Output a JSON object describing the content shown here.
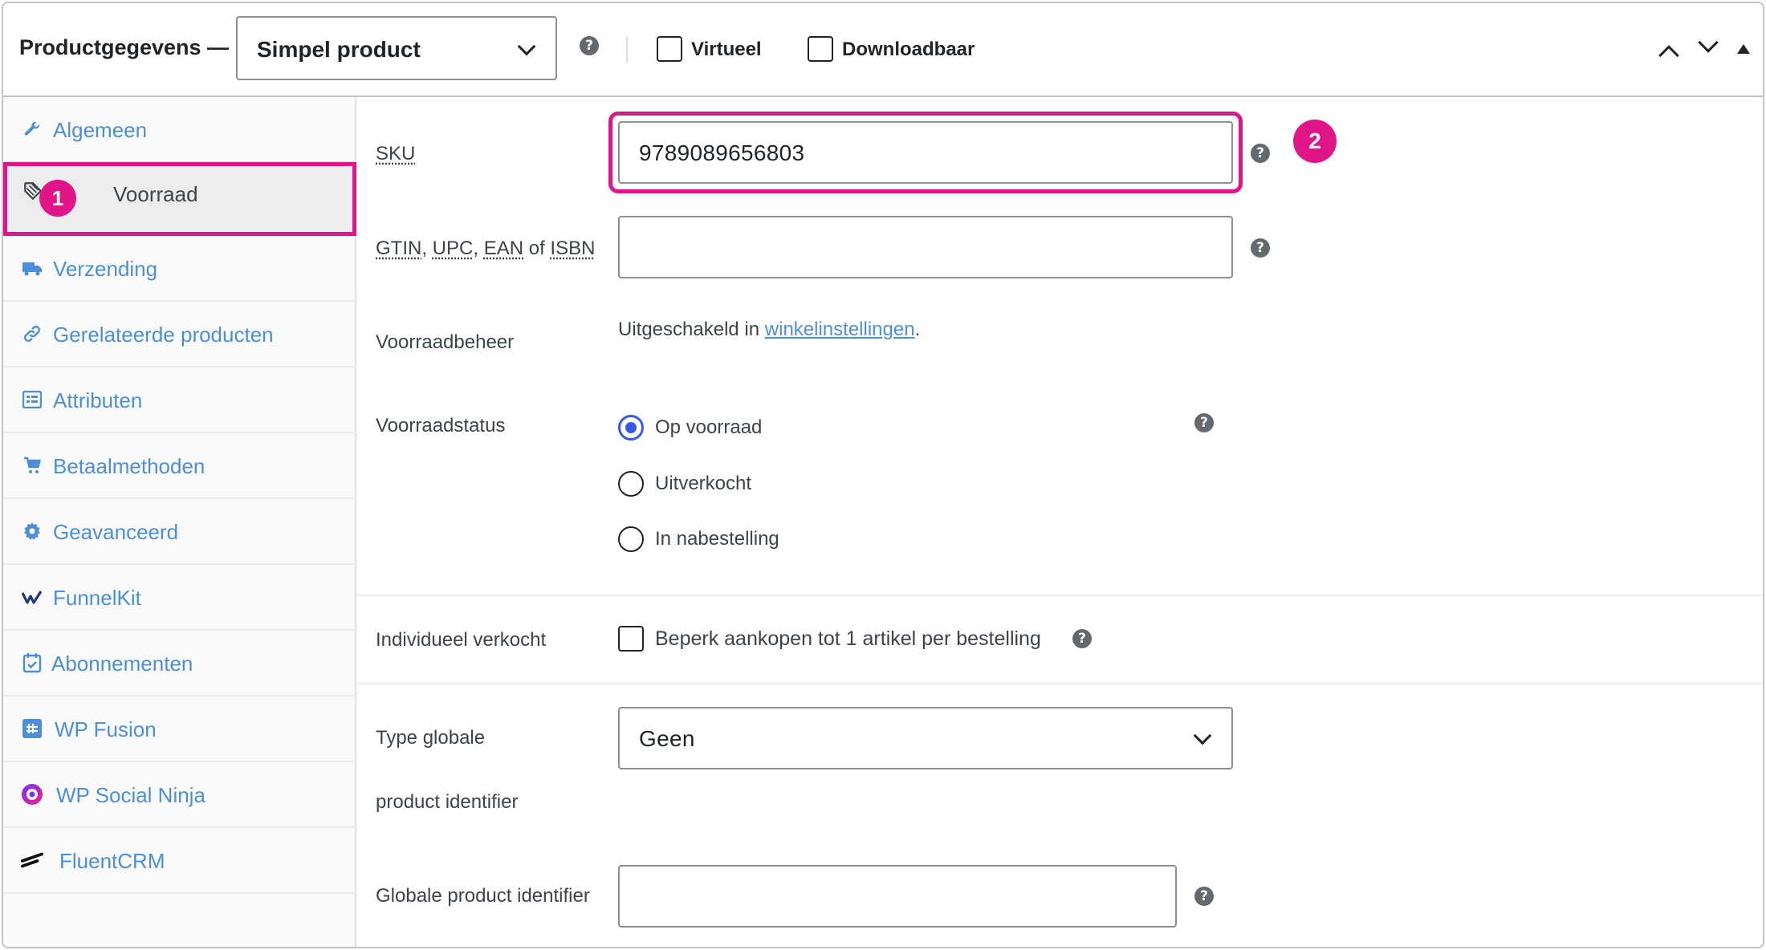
{
  "header": {
    "title": "Productgegevens —",
    "product_type": "Simpel product",
    "virtual_label": "Virtueel",
    "downloadable_label": "Downloadbaar",
    "help_glyph": "?"
  },
  "sidebar": {
    "items": [
      {
        "label": "Algemeen",
        "icon": "wrench-icon"
      },
      {
        "label": "Voorraad",
        "icon": "tag-icon",
        "active": true,
        "badge": "1"
      },
      {
        "label": "Verzending",
        "icon": "truck-icon"
      },
      {
        "label": "Gerelateerde producten",
        "icon": "link-icon"
      },
      {
        "label": "Attributen",
        "icon": "list-table-icon"
      },
      {
        "label": "Betaalmethoden",
        "icon": "cart-icon"
      },
      {
        "label": "Geavanceerd",
        "icon": "gear-icon"
      },
      {
        "label": "FunnelKit",
        "icon": "funnelkit-icon"
      },
      {
        "label": "Abonnementen",
        "icon": "calendar-icon"
      },
      {
        "label": "WP Fusion",
        "icon": "wp-fusion-icon"
      },
      {
        "label": "WP Social Ninja",
        "icon": "social-ninja-icon"
      },
      {
        "label": "FluentCRM",
        "icon": "fluentcrm-icon"
      }
    ]
  },
  "main": {
    "sku": {
      "label": "SKU",
      "value": "9789089656803",
      "badge": "2"
    },
    "gtin": {
      "label_gtin": "GTIN",
      "label_upc": "UPC",
      "label_ean": "EAN",
      "label_of": "of",
      "label_isbn": "ISBN",
      "value": ""
    },
    "stock_management": {
      "label": "Voorraadbeheer",
      "text": "Uitgeschakeld in",
      "link": "winkelinstellingen",
      "period": "."
    },
    "stock_status": {
      "label": "Voorraadstatus",
      "options": [
        "Op voorraad",
        "Uitverkocht",
        "In nabestelling"
      ],
      "selected": "Op voorraad"
    },
    "sold_individually": {
      "label": "Individueel verkocht",
      "checkbox_label": "Beperk aankopen tot 1 artikel per bestelling"
    },
    "global_identifier_type": {
      "label_line1": "Type globale",
      "label_line2": "product identifier",
      "value": "Geen"
    },
    "global_identifier": {
      "label": "Globale product identifier",
      "value": ""
    }
  },
  "colors": {
    "accent_pink": "#e0158a",
    "link_blue": "#4d8fd6",
    "radio_blue": "#3858e9"
  }
}
